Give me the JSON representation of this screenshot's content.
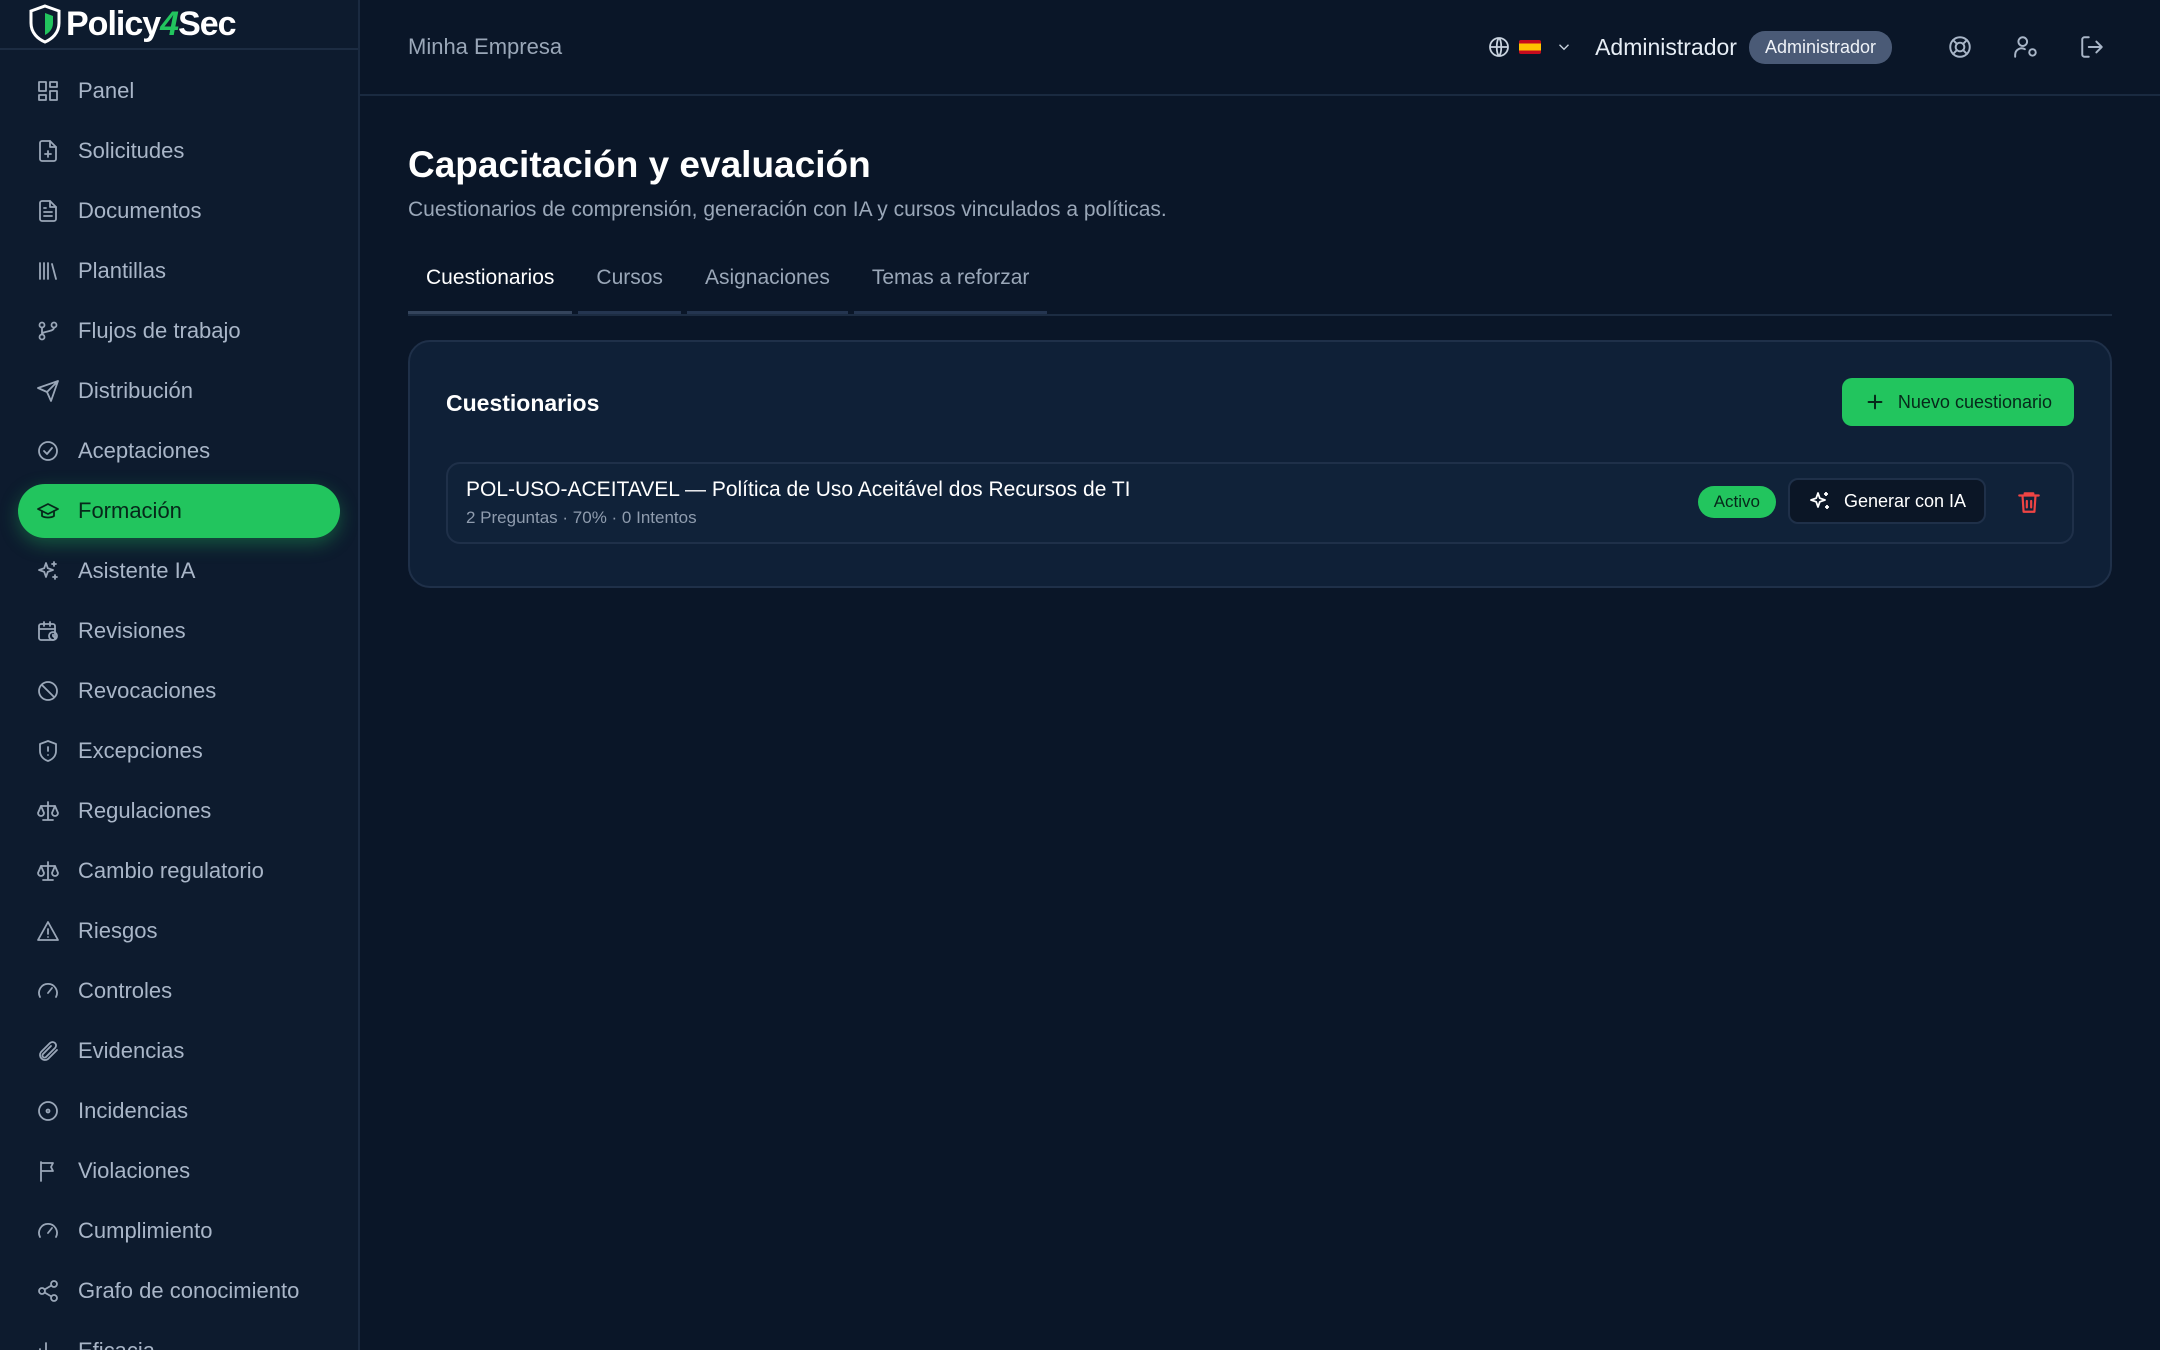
{
  "brand": {
    "name_part1": "Policy",
    "name_part2": "4",
    "name_part3": "Sec",
    "accent": "#22c55e"
  },
  "sidebar": {
    "items": [
      {
        "label": "Panel",
        "icon": "dashboard-icon"
      },
      {
        "label": "Solicitudes",
        "icon": "file-plus-icon"
      },
      {
        "label": "Documentos",
        "icon": "file-text-icon"
      },
      {
        "label": "Plantillas",
        "icon": "library-icon"
      },
      {
        "label": "Flujos de trabajo",
        "icon": "git-branch-icon"
      },
      {
        "label": "Distribución",
        "icon": "send-icon"
      },
      {
        "label": "Aceptaciones",
        "icon": "check-circle-icon"
      },
      {
        "label": "Formación",
        "icon": "graduation-cap-icon",
        "active": true
      },
      {
        "label": "Asistente IA",
        "icon": "sparkles-icon"
      },
      {
        "label": "Revisiones",
        "icon": "calendar-clock-icon"
      },
      {
        "label": "Revocaciones",
        "icon": "ban-icon"
      },
      {
        "label": "Excepciones",
        "icon": "shield-alert-icon"
      },
      {
        "label": "Regulaciones",
        "icon": "scale-icon"
      },
      {
        "label": "Cambio regulatorio",
        "icon": "scale-icon"
      },
      {
        "label": "Riesgos",
        "icon": "alert-triangle-icon"
      },
      {
        "label": "Controles",
        "icon": "gauge-icon"
      },
      {
        "label": "Evidencias",
        "icon": "paperclip-icon"
      },
      {
        "label": "Incidencias",
        "icon": "circle-dot-icon"
      },
      {
        "label": "Violaciones",
        "icon": "flag-icon"
      },
      {
        "label": "Cumplimiento",
        "icon": "gauge-icon"
      },
      {
        "label": "Grafo de conocimiento",
        "icon": "share-icon"
      },
      {
        "label": "Eficacia",
        "icon": "chart-icon"
      }
    ]
  },
  "topbar": {
    "company": "Minha Empresa",
    "user_name": "Administrador",
    "role": "Administrador"
  },
  "page": {
    "title": "Capacitación y evaluación",
    "subtitle": "Cuestionarios de comprensión, generación con IA y cursos vinculados a políticas.",
    "tabs": [
      {
        "label": "Cuestionarios",
        "active": true
      },
      {
        "label": "Cursos"
      },
      {
        "label": "Asignaciones"
      },
      {
        "label": "Temas a reforzar"
      }
    ]
  },
  "card": {
    "title": "Cuestionarios",
    "new_button": "Nuevo cuestionario",
    "quizzes": [
      {
        "name": "POL-USO-ACEITAVEL — Política de Uso Aceitável dos Recursos de TI",
        "meta": "2 Preguntas · 70% · 0 Intentos",
        "status": "Activo",
        "generate_label": "Generar con IA"
      }
    ]
  }
}
